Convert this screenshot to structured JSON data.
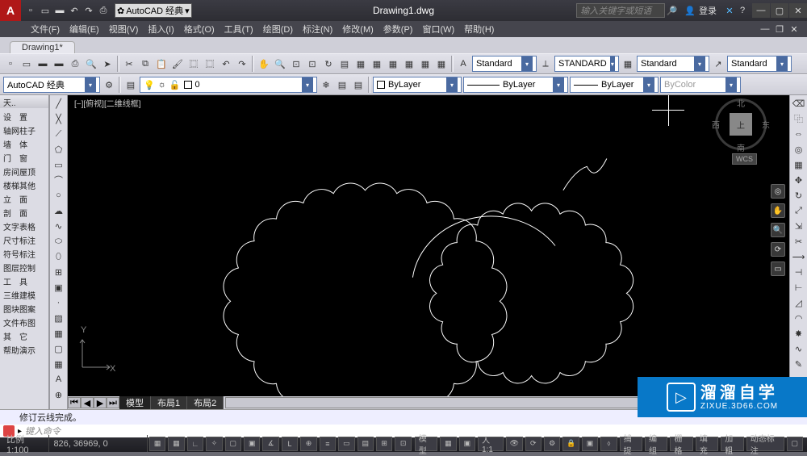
{
  "title": "Drawing1.dwg",
  "workspace": "AutoCAD 经典",
  "search_placeholder": "输入关键字或短语",
  "login": "登录",
  "menus": [
    "文件(F)",
    "编辑(E)",
    "视图(V)",
    "插入(I)",
    "格式(O)",
    "工具(T)",
    "绘图(D)",
    "标注(N)",
    "修改(M)",
    "参数(P)",
    "窗口(W)",
    "帮助(H)"
  ],
  "doc_tab": "Drawing1*",
  "style1": "Standard",
  "style2": "STANDARD",
  "style3": "Standard",
  "style4": "Standard",
  "workspace2": "AutoCAD 经典",
  "layer0": "0",
  "bylayer": "ByLayer",
  "bylayer2": "ByLayer",
  "bylayer3": "ByLayer",
  "bycolor": "ByColor",
  "side_header": "天..",
  "side_items": [
    "设　置",
    "轴网柱子",
    "墙　体",
    "门　窗",
    "房间屋顶",
    "楼梯其他",
    "立　面",
    "剖　面",
    "文字表格",
    "尺寸标注",
    "符号标注",
    "图层控制",
    "工　具",
    "三维建模",
    "图块图案",
    "文件布图",
    "其　它",
    "帮助演示"
  ],
  "vp_label": "[−][俯视][二维线框]",
  "vc": {
    "top": "上",
    "n": "北",
    "s": "南",
    "e": "东",
    "w": "西"
  },
  "wcs": "WCS",
  "model_tabs": [
    "模型",
    "布局1",
    "布局2"
  ],
  "cmd_history": "修订云线完成。",
  "cmd_placeholder": "键入命令",
  "status": {
    "scale_label": "比例 1:100",
    "coords": "826,    36969, 0",
    "model": "模型",
    "ann_scale": "人1:1",
    "mode_btns": [
      "捕捉",
      "编组",
      "栅格",
      "填充",
      "加粗",
      "动态标注"
    ]
  },
  "ucs": {
    "x": "X",
    "y": "Y"
  },
  "watermark": {
    "main": "溜溜自学",
    "sub": "ZIXUE.3D66.COM"
  }
}
